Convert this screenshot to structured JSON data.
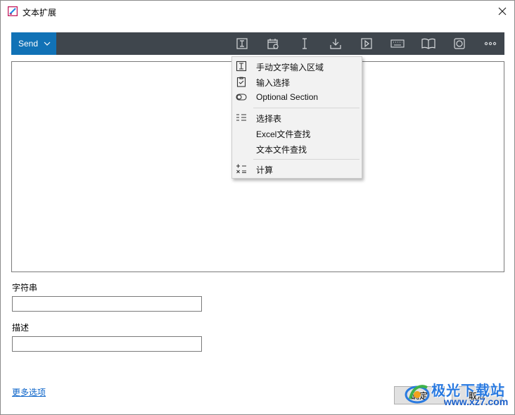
{
  "window": {
    "title": "文本扩展"
  },
  "toolbar": {
    "send_label": "Send",
    "icons": [
      "text-field-icon",
      "calendar-icon",
      "text-cursor-icon",
      "download-icon",
      "play-icon",
      "keyboard-icon",
      "book-icon",
      "snippet-icon",
      "more-icon"
    ]
  },
  "menu": {
    "items": [
      {
        "label": "手动文字输入区域",
        "icon": "text-field-icon"
      },
      {
        "label": "输入选择",
        "icon": "clipboard-check-icon"
      },
      {
        "label": "Optional Section",
        "icon": "toggle-icon"
      },
      {
        "label": "选择表",
        "icon": "list-icon"
      },
      {
        "label": "Excel文件查找",
        "icon": ""
      },
      {
        "label": "文本文件查找",
        "icon": ""
      },
      {
        "label": "计算",
        "icon": "calculator-icon"
      }
    ]
  },
  "fields": {
    "string_label": "字符串",
    "string_value": "",
    "description_label": "描述",
    "description_value": ""
  },
  "footer": {
    "more_options": "更多选项",
    "ok": "确定",
    "cancel": "取消"
  },
  "watermark": {
    "title": "极光下载站",
    "url": "www.xz7.com"
  }
}
